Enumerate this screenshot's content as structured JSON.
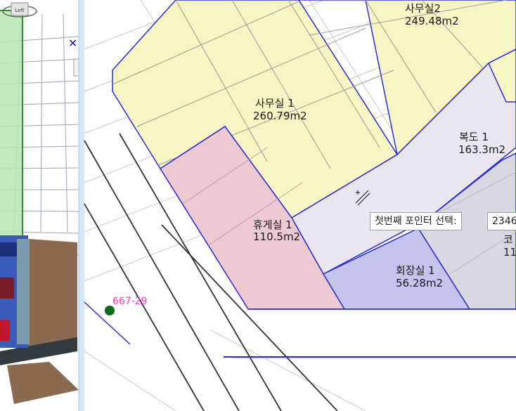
{
  "viewcube": {
    "label": "Left"
  },
  "rooms": [
    {
      "name": "사무실2",
      "area": "249.48m2"
    },
    {
      "name": "사무실 1",
      "area": "260.79m2"
    },
    {
      "name": "복도 1",
      "area": "163.3m2"
    },
    {
      "name": "휴게실 1",
      "area": "110.5m2"
    },
    {
      "name": "회장실 1",
      "area": "56.28m2"
    },
    {
      "name": "코",
      "area": "11"
    }
  ],
  "tooltip": {
    "prompt": "첫번째 포인터 선택:",
    "coordinate": "2346"
  },
  "parcel": {
    "label": "667-29"
  },
  "colors": {
    "office": "#f7f5c3",
    "corridor": "#e9e6f2",
    "lounge": "#ecc9d3",
    "chairman": "#c4c4ee",
    "outline": "#2b2bd6",
    "parcel_text": "#ff33cc",
    "parcel_point": "#0a6b1c"
  }
}
